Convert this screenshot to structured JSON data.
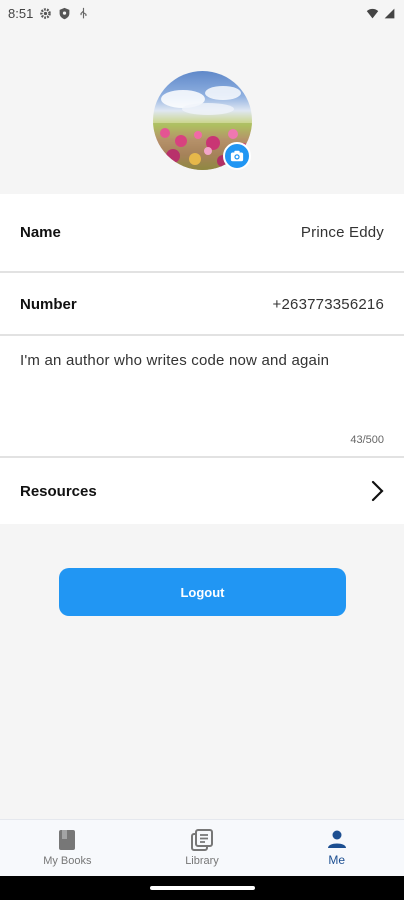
{
  "status_bar": {
    "time": "8:51",
    "left_icons": [
      "gear-icon",
      "shield-icon",
      "usb-icon"
    ],
    "right_icons": [
      "wifi-icon",
      "signal-icon"
    ]
  },
  "profile": {
    "avatar_icon": "avatar-photo-flowers",
    "camera_icon": "camera-icon"
  },
  "fields": {
    "name_label": "Name",
    "name_value": "Prince Eddy",
    "number_label": "Number",
    "number_value": "+263773356216",
    "bio_text": "I'm an author who writes code now and again",
    "bio_counter": "43/500",
    "resources_label": "Resources"
  },
  "actions": {
    "logout_label": "Logout"
  },
  "bottom_nav": {
    "items": [
      {
        "label": "My Books",
        "icon": "book-icon",
        "active": false
      },
      {
        "label": "Library",
        "icon": "library-icon",
        "active": false
      },
      {
        "label": "Me",
        "icon": "person-icon",
        "active": true
      }
    ]
  },
  "colors": {
    "accent": "#2196f3",
    "nav_active": "#1d4f91",
    "background": "#f5f5f5"
  }
}
